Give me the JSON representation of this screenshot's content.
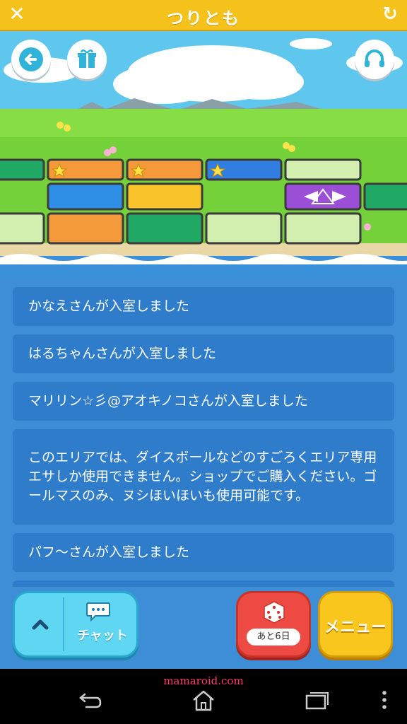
{
  "app": {
    "title": "つりとも"
  },
  "chat_log": {
    "messages": [
      "かなえさんが入室しました",
      "はるちゃんさんが入室しました",
      "マリリン☆彡@アオキノコさんが入室しました",
      "このエリアでは、ダイスボールなどのすごろくエリア専用エサしか使用できません。ショップでご購入ください。ゴールマスのみ、ヌシほいほいも使用可能です。",
      "パフ～さんが入室しました"
    ]
  },
  "controls": {
    "chat_label": "チャット",
    "dice_remaining": "あと6日",
    "menu_label": "メニュー"
  },
  "watermark": "mamaroid.com",
  "colors": {
    "title_bar": "#f5c21b",
    "message_bg": "#2f7ccb",
    "chat_button": "#5fd7f2",
    "dice_button": "#ec4a42",
    "menu_button": "#f9c61e"
  },
  "icons": {
    "close": "close-icon",
    "reload": "reload-icon",
    "back": "back-arrow-icon",
    "gift": "gift-icon",
    "headset": "headset-icon",
    "chevron": "chevron-up-icon",
    "chat": "chat-bubble-icon",
    "dice": "dice-icon",
    "nav_back": "nav-back-icon",
    "nav_home": "nav-home-icon",
    "nav_recents": "nav-recents-icon",
    "nav_more": "nav-more-icon"
  }
}
